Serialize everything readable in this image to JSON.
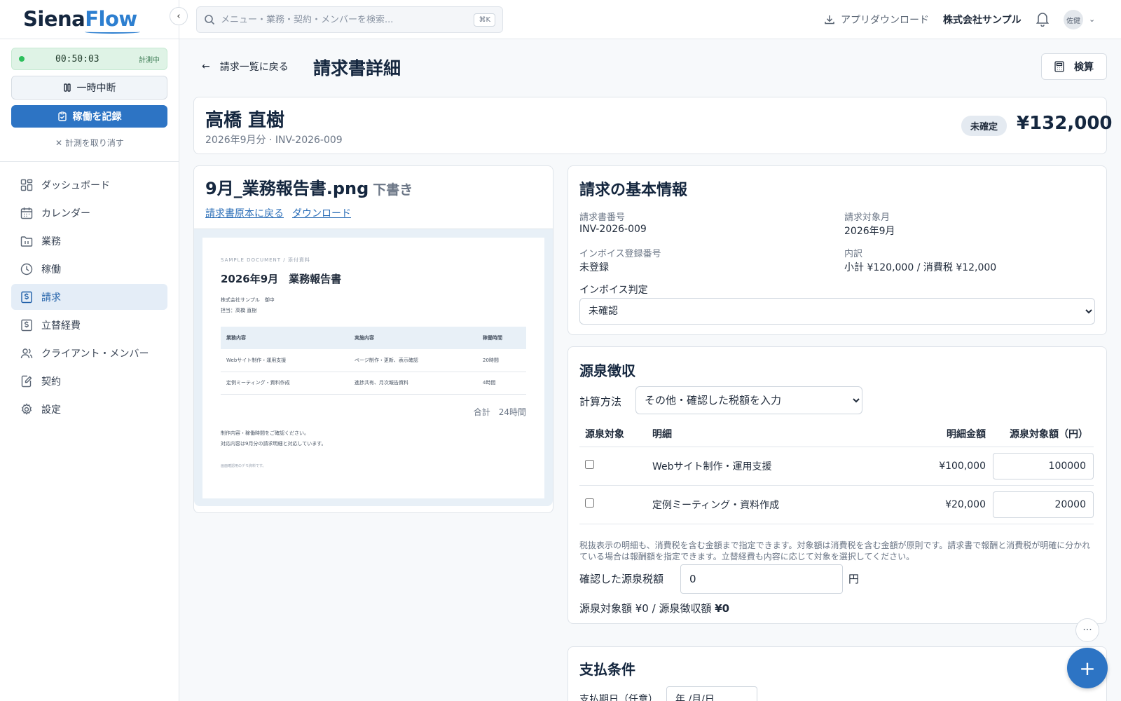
{
  "brand": {
    "part1": "Siena",
    "part2": "Flow"
  },
  "sidebar": {
    "timer": {
      "time": "00:50:03",
      "status": "計測中"
    },
    "pause_label": "一時中断",
    "record_label": "稼働を記録",
    "cancel_label": "計測を取り消す",
    "items": [
      {
        "label": "ダッシュボード",
        "icon": "dashboard-icon"
      },
      {
        "label": "カレンダー",
        "icon": "calendar-icon"
      },
      {
        "label": "業務",
        "icon": "folder-icon"
      },
      {
        "label": "稼働",
        "icon": "clock-icon"
      },
      {
        "label": "請求",
        "icon": "invoice-icon"
      },
      {
        "label": "立替経費",
        "icon": "expense-icon"
      },
      {
        "label": "クライアント・メンバー",
        "icon": "users-icon"
      },
      {
        "label": "契約",
        "icon": "contract-icon"
      },
      {
        "label": "設定",
        "icon": "gear-icon"
      }
    ]
  },
  "topbar": {
    "search_placeholder": "メニュー・業務・契約・メンバーを検索...",
    "shortcut": "⌘K",
    "app_download": "アプリダウンロード",
    "company": "株式会社サンプル",
    "avatar": "佐健"
  },
  "header": {
    "back_label": "請求一覧に戻る",
    "title": "請求書詳細",
    "calc_label": "検算"
  },
  "invoice": {
    "client_name": "高橋 直樹",
    "subtitle": "2026年9月分 · INV-2026-009",
    "status": "未確定",
    "total": "¥132,000"
  },
  "attachment": {
    "filename": "9月_業務報告書.png",
    "draft_label": "下書き",
    "back_link": "請求書原本に戻る",
    "download_link": "ダウンロード",
    "doc": {
      "eyebrow": "SAMPLE DOCUMENT / 添付資料",
      "title": "2026年9月　業務報告書",
      "meta1": "株式会社サンプル　御中",
      "meta2": "担当：高橋 直樹",
      "headers": [
        "業務内容",
        "実施内容",
        "稼働時間"
      ],
      "rows": [
        [
          "Webサイト制作・運用支援",
          "ページ制作・更新、表示確認",
          "20時間"
        ],
        [
          "定例ミーティング・資料作成",
          "進捗共有、月次報告資料",
          "4時間"
        ]
      ],
      "total": "合計　24時間",
      "note1": "制作内容・稼働時間をご確認ください。",
      "note2": "対応内容は9月分の請求明細と対応しています。",
      "footer": "画面確認用のデモ資料です。"
    }
  },
  "basic_info": {
    "title": "請求の基本情報",
    "invoice_number_label": "請求書番号",
    "invoice_number": "INV-2026-009",
    "target_month_label": "請求対象月",
    "target_month": "2026年9月",
    "registration_label": "インボイス登録番号",
    "registration": "未登録",
    "breakdown_label": "内訳",
    "breakdown": "小計 ¥120,000 / 消費税 ¥12,000",
    "judgement_label": "インボイス判定",
    "judgement_value": "未確認"
  },
  "withholding": {
    "title": "源泉徴収",
    "method_label": "計算方法",
    "method_value": "その他・確認した税額を入力",
    "headers": [
      "源泉対象",
      "明細",
      "明細金額",
      "源泉対象額（円）"
    ],
    "rows": [
      {
        "item": "Webサイト制作・運用支援",
        "amount": "¥100,000",
        "target": "100000",
        "checked": false
      },
      {
        "item": "定例ミーティング・資料作成",
        "amount": "¥20,000",
        "target": "20000",
        "checked": false
      }
    ],
    "note": "税抜表示の明細も、消費税を含む金額まで指定できます。対象額は消費税を含む金額が原則です。請求書で報酬と消費税が明確に分かれている場合は報酬額を指定できます。立替経費も内容に応じて対象を選択してください。",
    "tax_label": "確認した源泉税額",
    "tax_value": "0",
    "unit": "円",
    "summary_prefix": "源泉対象額 ¥0 / 源泉徴収額 ",
    "summary_amount": "¥0"
  },
  "payment": {
    "title": "支払条件",
    "due_label": "支払期日（任意）",
    "due_placeholder": "年 /月/日"
  },
  "fab": {
    "more": "···",
    "add": "+"
  }
}
